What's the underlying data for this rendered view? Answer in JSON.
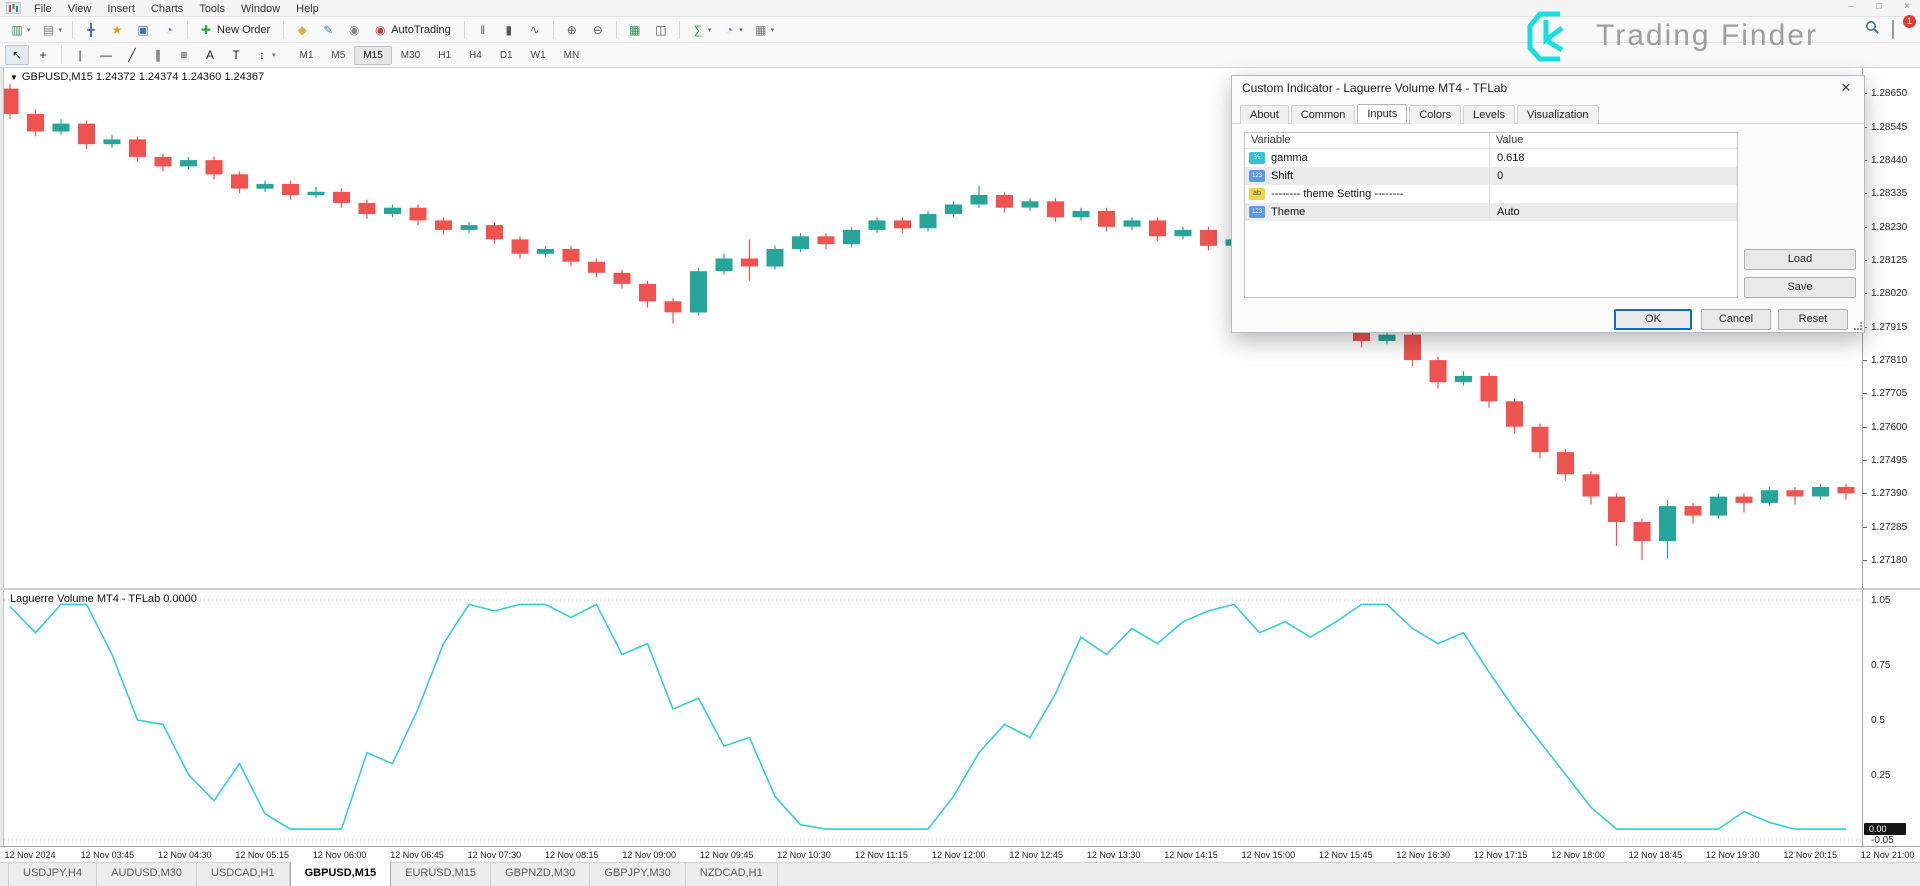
{
  "menu": {
    "items": [
      "File",
      "View",
      "Insert",
      "Charts",
      "Tools",
      "Window",
      "Help"
    ]
  },
  "window_controls": {
    "minimize": "–",
    "maximize": "□",
    "close": "×"
  },
  "topbar": {
    "notification_badge": "1"
  },
  "watermark": {
    "brand": "Trading Finder",
    "mark_color": "#19dede"
  },
  "toolbar_main": {
    "items": [
      {
        "name": "new-chart-button",
        "glyph": "▥",
        "color": "#3c8c5c",
        "caret": true
      },
      {
        "name": "profiles-button",
        "glyph": "▤",
        "color": "#7a7a7a",
        "caret": true
      },
      {
        "sep": true
      },
      {
        "name": "market-watch-icon",
        "glyph": "╋",
        "color": "#4a6fa5"
      },
      {
        "name": "navigator-icon",
        "glyph": "★",
        "color": "#d9a700"
      },
      {
        "name": "terminal-icon",
        "glyph": "▣",
        "color": "#4a6fa5"
      },
      {
        "name": "strategy-tester-icon",
        "glyph": "◔",
        "color": "#4a6fa5"
      },
      {
        "sep": true
      },
      {
        "name": "new-order-button",
        "glyph": "✚",
        "color": "#2e9e4f",
        "label": "New Order"
      },
      {
        "sep": true
      },
      {
        "name": "metaeditor-icon",
        "glyph": "◆",
        "color": "#d9b23a"
      },
      {
        "name": "metaquotes-icon",
        "glyph": "✎",
        "color": "#4a86c8"
      },
      {
        "name": "sounds-icon",
        "glyph": "◉",
        "color": "#8a8a8a"
      },
      {
        "name": "autotrading-button",
        "glyph": "◉",
        "color": "#c94343",
        "label": "AutoTrading"
      },
      {
        "sep": true
      },
      {
        "name": "bars-mode-icon",
        "glyph": "‖",
        "color": "#555555"
      },
      {
        "name": "candles-mode-icon",
        "glyph": "▮",
        "color": "#555555"
      },
      {
        "name": "line-mode-icon",
        "glyph": "∿",
        "color": "#555555"
      },
      {
        "sep": true
      },
      {
        "name": "zoom-in-icon",
        "glyph": "⊕",
        "color": "#555555"
      },
      {
        "name": "zoom-out-icon",
        "glyph": "⊖",
        "color": "#555555"
      },
      {
        "sep": true
      },
      {
        "name": "tile-windows-icon",
        "glyph": "▦",
        "color": "#3c8c5c"
      },
      {
        "name": "cascade-windows-icon",
        "glyph": "◫",
        "color": "#555555"
      },
      {
        "sep": true
      },
      {
        "name": "indicators-button",
        "glyph": "∑",
        "color": "#2e9e4f",
        "caret": true
      },
      {
        "name": "periods-button",
        "glyph": "◔",
        "color": "#4a6fa5",
        "caret": true
      },
      {
        "name": "templates-button",
        "glyph": "▦",
        "color": "#7a7a7a",
        "caret": true
      }
    ]
  },
  "toolbar_draw": {
    "items": [
      {
        "name": "cursor-button",
        "glyph": "↖",
        "color": "#222222",
        "pressed": true
      },
      {
        "name": "crosshair-button",
        "glyph": "+",
        "color": "#222222"
      },
      {
        "sep": true
      },
      {
        "name": "vertical-line-icon",
        "glyph": "|",
        "color": "#222222"
      },
      {
        "name": "horizontal-line-icon",
        "glyph": "—",
        "color": "#222222"
      },
      {
        "name": "trendline-icon",
        "glyph": "╱",
        "color": "#222222"
      },
      {
        "name": "channel-icon",
        "glyph": "∥",
        "color": "#222222"
      },
      {
        "name": "fibonacci-icon",
        "glyph": "≡",
        "color": "#222222"
      },
      {
        "name": "text-icon",
        "glyph": "A",
        "color": "#222222"
      },
      {
        "name": "label-icon",
        "glyph": "T",
        "color": "#222222"
      },
      {
        "name": "shapes-icon",
        "glyph": "↕",
        "color": "#222222",
        "caret": true
      }
    ]
  },
  "timeframes": {
    "items": [
      "M1",
      "M5",
      "M15",
      "M30",
      "H1",
      "H4",
      "D1",
      "W1",
      "MN"
    ],
    "active": "M15"
  },
  "chart": {
    "title": "GBPUSD,M15  1.24372 1.24374 1.24360 1.24367"
  },
  "indicator": {
    "label": "Laguerre Volume MT4 - TFLab 0.0000",
    "current_value": "0.00"
  },
  "chart_data": {
    "type": "candlestick+line",
    "symbol": "GBPUSD,M15",
    "bull_color": "#26a69a",
    "bear_color": "#ef5350",
    "price_axis": {
      "top": 1.2873,
      "scale": 3.15e-05,
      "ticks": [
        1.2865,
        1.28545,
        1.2844,
        1.28335,
        1.2823,
        1.28125,
        1.2802,
        1.27915,
        1.2781,
        1.27705,
        1.276,
        1.27495,
        1.2739,
        1.27285,
        1.2718
      ]
    },
    "candles": [
      [
        1.28665,
        1.2868,
        1.2857,
        1.28585
      ],
      [
        1.28585,
        1.286,
        1.28515,
        1.2853
      ],
      [
        1.2853,
        1.2857,
        1.2852,
        1.28555
      ],
      [
        1.28555,
        1.28565,
        1.28475,
        1.2849
      ],
      [
        1.2849,
        1.2852,
        1.2848,
        1.28505
      ],
      [
        1.28505,
        1.28515,
        1.28435,
        1.2845
      ],
      [
        1.2845,
        1.2846,
        1.28405,
        1.2842
      ],
      [
        1.2842,
        1.2845,
        1.2841,
        1.2844
      ],
      [
        1.2844,
        1.2845,
        1.2838,
        1.28395
      ],
      [
        1.28395,
        1.28405,
        1.28335,
        1.2835
      ],
      [
        1.2835,
        1.28375,
        1.2834,
        1.28365
      ],
      [
        1.28365,
        1.28375,
        1.28315,
        1.2833
      ],
      [
        1.2833,
        1.28355,
        1.2832,
        1.2834
      ],
      [
        1.2834,
        1.2835,
        1.2829,
        1.28305
      ],
      [
        1.28305,
        1.28315,
        1.28255,
        1.2827
      ],
      [
        1.2827,
        1.283,
        1.2826,
        1.2829
      ],
      [
        1.2829,
        1.283,
        1.28235,
        1.2825
      ],
      [
        1.2825,
        1.2826,
        1.28205,
        1.2822
      ],
      [
        1.2822,
        1.28245,
        1.2821,
        1.28235
      ],
      [
        1.28235,
        1.28245,
        1.28175,
        1.2819
      ],
      [
        1.2819,
        1.282,
        1.2813,
        1.28145
      ],
      [
        1.28145,
        1.2817,
        1.28135,
        1.2816
      ],
      [
        1.2816,
        1.2817,
        1.28105,
        1.2812
      ],
      [
        1.2812,
        1.2813,
        1.2807,
        1.28085
      ],
      [
        1.28085,
        1.28095,
        1.28035,
        1.2805
      ],
      [
        1.2805,
        1.2806,
        1.27975,
        1.27995
      ],
      [
        1.27995,
        1.28005,
        1.27925,
        1.2796
      ],
      [
        1.2796,
        1.281,
        1.2795,
        1.2809
      ],
      [
        1.2809,
        1.28145,
        1.2808,
        1.2813
      ],
      [
        1.2813,
        1.2819,
        1.2806,
        1.28105
      ],
      [
        1.28105,
        1.2817,
        1.28095,
        1.2816
      ],
      [
        1.2816,
        1.2821,
        1.2815,
        1.282
      ],
      [
        1.282,
        1.2821,
        1.2816,
        1.28175
      ],
      [
        1.28175,
        1.2823,
        1.28165,
        1.2822
      ],
      [
        1.2822,
        1.2826,
        1.2821,
        1.2825
      ],
      [
        1.2825,
        1.2826,
        1.2821,
        1.28225
      ],
      [
        1.28225,
        1.2828,
        1.28215,
        1.2827
      ],
      [
        1.2827,
        1.2831,
        1.2826,
        1.283
      ],
      [
        1.283,
        1.2836,
        1.2829,
        1.2833
      ],
      [
        1.2833,
        1.2834,
        1.28275,
        1.2829
      ],
      [
        1.2829,
        1.2832,
        1.2828,
        1.2831
      ],
      [
        1.2831,
        1.2832,
        1.28245,
        1.2826
      ],
      [
        1.2826,
        1.2829,
        1.2825,
        1.2828
      ],
      [
        1.2828,
        1.2829,
        1.28215,
        1.2823
      ],
      [
        1.2823,
        1.2826,
        1.2822,
        1.2825
      ],
      [
        1.2825,
        1.2826,
        1.28185,
        1.282
      ],
      [
        1.282,
        1.2823,
        1.2819,
        1.2822
      ],
      [
        1.2822,
        1.2823,
        1.28155,
        1.2817
      ],
      [
        1.2817,
        1.282,
        1.2816,
        1.2819
      ],
      [
        1.2819,
        1.282,
        1.28125,
        1.2814
      ],
      [
        1.2814,
        1.2815,
        1.28075,
        1.2809
      ],
      [
        1.2809,
        1.281,
        1.28,
        1.2802
      ],
      [
        1.2802,
        1.2803,
        1.2792,
        1.2794
      ],
      [
        1.2794,
        1.2795,
        1.2785,
        1.2787
      ],
      [
        1.2787,
        1.27905,
        1.2786,
        1.2789
      ],
      [
        1.2789,
        1.279,
        1.2779,
        1.2781
      ],
      [
        1.2781,
        1.2782,
        1.2772,
        1.2774
      ],
      [
        1.2774,
        1.27775,
        1.2773,
        1.2776
      ],
      [
        1.2776,
        1.2777,
        1.2766,
        1.2768
      ],
      [
        1.2768,
        1.2769,
        1.2758,
        1.276
      ],
      [
        1.276,
        1.2761,
        1.275,
        1.2752
      ],
      [
        1.2752,
        1.2753,
        1.2743,
        1.2745
      ],
      [
        1.2745,
        1.2746,
        1.27355,
        1.2738
      ],
      [
        1.2738,
        1.2739,
        1.27225,
        1.273
      ],
      [
        1.273,
        1.2731,
        1.2718,
        1.2724
      ],
      [
        1.2724,
        1.2737,
        1.27185,
        1.2735
      ],
      [
        1.2735,
        1.2736,
        1.27295,
        1.2732
      ],
      [
        1.2732,
        1.2739,
        1.2731,
        1.2738
      ],
      [
        1.2738,
        1.2739,
        1.2733,
        1.2736
      ],
      [
        1.2736,
        1.2741,
        1.2735,
        1.274
      ],
      [
        1.274,
        1.2741,
        1.27355,
        1.2738
      ],
      [
        1.2738,
        1.2742,
        1.2737,
        1.2741
      ],
      [
        1.2741,
        1.2742,
        1.2737,
        1.2739
      ]
    ],
    "indicator": {
      "name": "Laguerre Volume MT4 - TFLab",
      "color": "#33cfcf",
      "max": 1.05,
      "min": -0.05,
      "levels": [
        1.05,
        -0.05
      ],
      "ticks": [
        [
          1.05,
          "1.05"
        ],
        [
          0.75,
          "0.75"
        ],
        [
          0.5,
          "0.5"
        ],
        [
          0.25,
          "0.25"
        ],
        [
          -0.05,
          "-0.05"
        ]
      ],
      "values": [
        1.02,
        0.9,
        1.03,
        1.03,
        0.8,
        0.5,
        0.48,
        0.25,
        0.13,
        0.3,
        0.07,
        0.0,
        0.0,
        0.0,
        0.35,
        0.3,
        0.55,
        0.85,
        1.03,
        1.0,
        1.03,
        1.03,
        0.97,
        1.03,
        0.8,
        0.85,
        0.55,
        0.6,
        0.38,
        0.42,
        0.15,
        0.02,
        0.0,
        0.0,
        0.0,
        0.0,
        0.0,
        0.15,
        0.35,
        0.48,
        0.42,
        0.62,
        0.88,
        0.8,
        0.92,
        0.85,
        0.95,
        1.0,
        1.03,
        0.9,
        0.95,
        0.88,
        0.95,
        1.03,
        1.03,
        0.92,
        0.85,
        0.9,
        0.72,
        0.55,
        0.4,
        0.25,
        0.1,
        0.0,
        0.0,
        0.0,
        0.0,
        0.0,
        0.08,
        0.03,
        0.0,
        0.0,
        0.0
      ]
    },
    "time_labels": [
      "12 Nov 2024",
      "12 Nov 03:45",
      "12 Nov 04:30",
      "12 Nov 05:15",
      "12 Nov 06:00",
      "12 Nov 06:45",
      "12 Nov 07:30",
      "12 Nov 08:15",
      "12 Nov 09:00",
      "12 Nov 09:45",
      "12 Nov 10:30",
      "12 Nov 11:15",
      "12 Nov 12:00",
      "12 Nov 12:45",
      "12 Nov 13:30",
      "12 Nov 14:15",
      "12 Nov 15:00",
      "12 Nov 15:45",
      "12 Nov 16:30",
      "12 Nov 17:15",
      "12 Nov 18:00",
      "12 Nov 18:45",
      "12 Nov 19:30",
      "12 Nov 20:15",
      "12 Nov 21:00"
    ]
  },
  "dialog": {
    "title": "Custom Indicator - Laguerre Volume MT4 - TFLab",
    "close_glyph": "✕",
    "tabs": [
      "About",
      "Common",
      "Inputs",
      "Colors",
      "Levels",
      "Visualization"
    ],
    "active_tab": "Inputs",
    "table": {
      "headers": [
        "Variable",
        "Value"
      ],
      "rows": [
        {
          "icon": "double",
          "name": "gamma",
          "value": "0.618"
        },
        {
          "icon": "int",
          "name": "Shift",
          "value": "0"
        },
        {
          "icon": "string",
          "name": "-------- theme Setting --------",
          "value": ""
        },
        {
          "icon": "int",
          "name": "Theme",
          "value": "Auto"
        }
      ]
    },
    "buttons": {
      "load": "Load",
      "save": "Save",
      "ok": "OK",
      "cancel": "Cancel",
      "reset": "Reset"
    }
  },
  "bottom_tabs": {
    "items": [
      "USDJPY,H4",
      "AUDUSD,M30",
      "USDCAD,H1",
      "GBPUSD,M15",
      "EURUSD,M15",
      "GBPNZD,M30",
      "GBPJPY,M30",
      "NZDCAD,H1"
    ],
    "active": "GBPUSD,M15"
  }
}
